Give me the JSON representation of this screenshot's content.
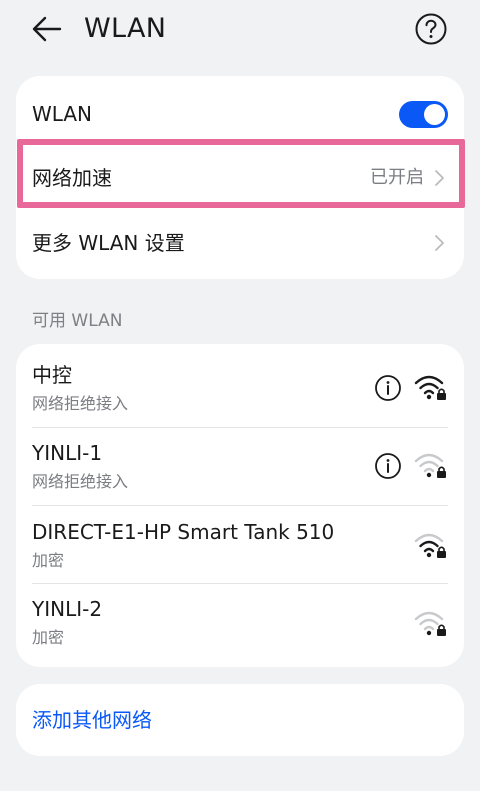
{
  "header": {
    "title": "WLAN",
    "back_icon": "arrow-left-icon",
    "help_icon": "question-circle-icon"
  },
  "settings": {
    "wlan_label": "WLAN",
    "wlan_enabled": true,
    "accel_label": "网络加速",
    "accel_value": "已开启",
    "more_label": "更多 WLAN 设置"
  },
  "available": {
    "section_title": "可用 WLAN",
    "networks": [
      {
        "name": "中控",
        "status": "网络拒绝接入",
        "has_info": true,
        "signal": "strong"
      },
      {
        "name": "YINLI-1",
        "status": "网络拒绝接入",
        "has_info": true,
        "signal": "weak"
      },
      {
        "name": "DIRECT-E1-HP Smart Tank 510",
        "status": "加密",
        "has_info": false,
        "signal": "medium"
      },
      {
        "name": "YINLI-2",
        "status": "加密",
        "has_info": false,
        "signal": "weak"
      }
    ]
  },
  "add_network": {
    "label": "添加其他网络"
  },
  "colors": {
    "accent": "#0a59f7",
    "highlight": "#e9689a",
    "background": "#f1f2f4",
    "card": "#ffffff",
    "secondary_text": "#7b7d82"
  }
}
